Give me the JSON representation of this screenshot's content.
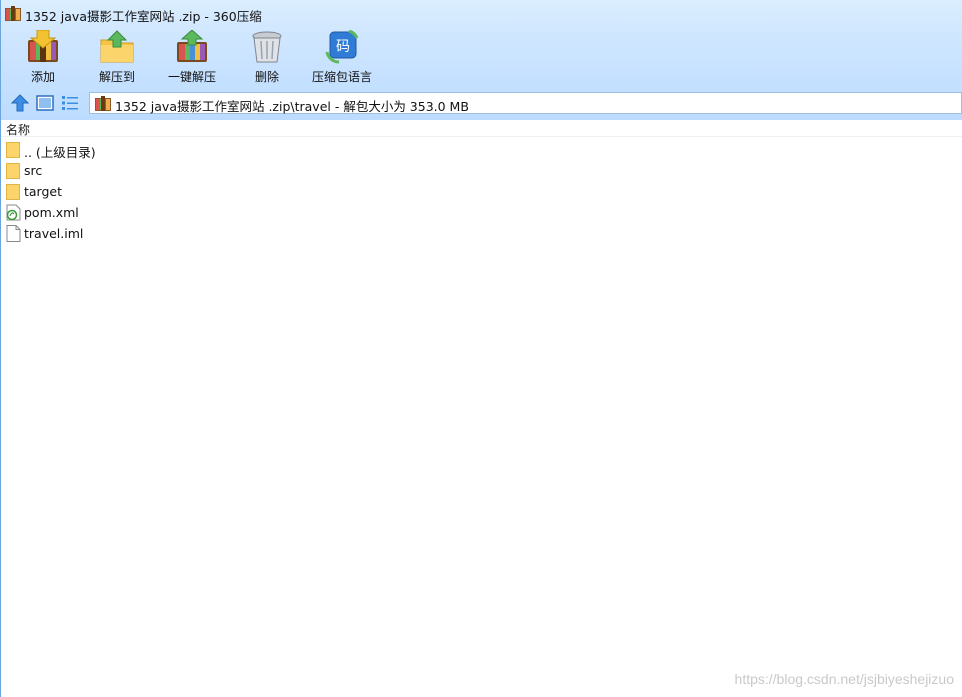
{
  "window": {
    "title": "1352 java摄影工作室网站 .zip - 360压缩"
  },
  "toolbar": {
    "add": "添加",
    "extract_to": "解压到",
    "one_click_extract": "一键解压",
    "delete": "删除",
    "archive_encoding": "压缩包语言"
  },
  "toolbar_icons": {
    "add": "books-add-icon",
    "extract_to": "folder-extract-icon",
    "one_click_extract": "books-extract-icon",
    "delete": "trash-bin-icon",
    "archive_encoding": "encoding-icon",
    "archive_encoding_glyph": "码"
  },
  "address": {
    "path": "1352 java摄影工作室网站 .zip\\travel - 解包大小为 353.0 MB"
  },
  "columns": {
    "name": "名称"
  },
  "files": [
    {
      "name": ".. (上级目录)",
      "type": "folder"
    },
    {
      "name": "src",
      "type": "folder"
    },
    {
      "name": "target",
      "type": "folder"
    },
    {
      "name": "pom.xml",
      "type": "xml"
    },
    {
      "name": "travel.iml",
      "type": "file"
    }
  ],
  "watermark": "https://blog.csdn.net/jsjbiyeshejizuo",
  "colors": {
    "toolbar_bg": "#cfe6ff",
    "folder": "#fbd46b",
    "accent": "#3a8ee6"
  }
}
